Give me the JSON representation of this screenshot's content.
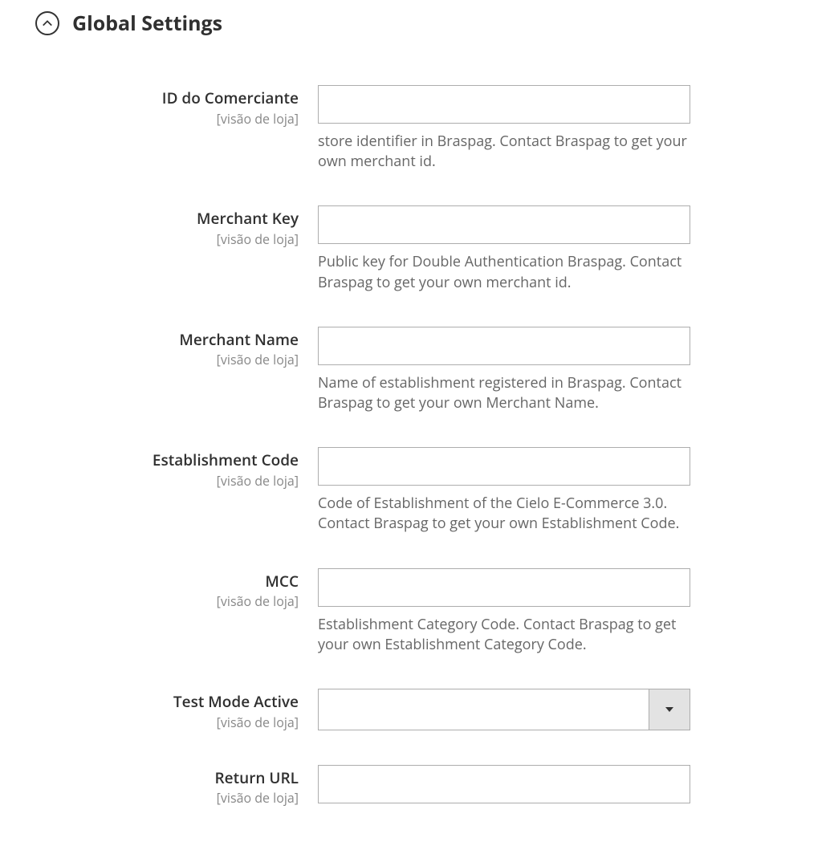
{
  "section": {
    "title": "Global Settings"
  },
  "scopeLabel": "[visão de loja]",
  "fields": {
    "merchantId": {
      "label": "ID do Comerciante",
      "value": "",
      "help": "store identifier in Braspag. Contact Braspag to get your own merchant id."
    },
    "merchantKey": {
      "label": "Merchant Key",
      "value": "",
      "help": "Public key for Double Authentication Braspag. Contact Braspag to get your own merchant id."
    },
    "merchantName": {
      "label": "Merchant Name",
      "value": "",
      "help": "Name of establishment registered in Braspag. Contact Braspag to get your own Merchant Name."
    },
    "establishmentCode": {
      "label": "Establishment Code",
      "value": "",
      "help": "Code of Establishment of the Cielo E-Commerce 3.0. Contact Braspag to get your own Establishment Code."
    },
    "mcc": {
      "label": "MCC",
      "value": "",
      "help": "Establishment Category Code. Contact Braspag to get your own Establishment Category Code."
    },
    "testMode": {
      "label": "Test Mode Active",
      "value": ""
    },
    "returnUrl": {
      "label": "Return URL",
      "value": ""
    }
  }
}
